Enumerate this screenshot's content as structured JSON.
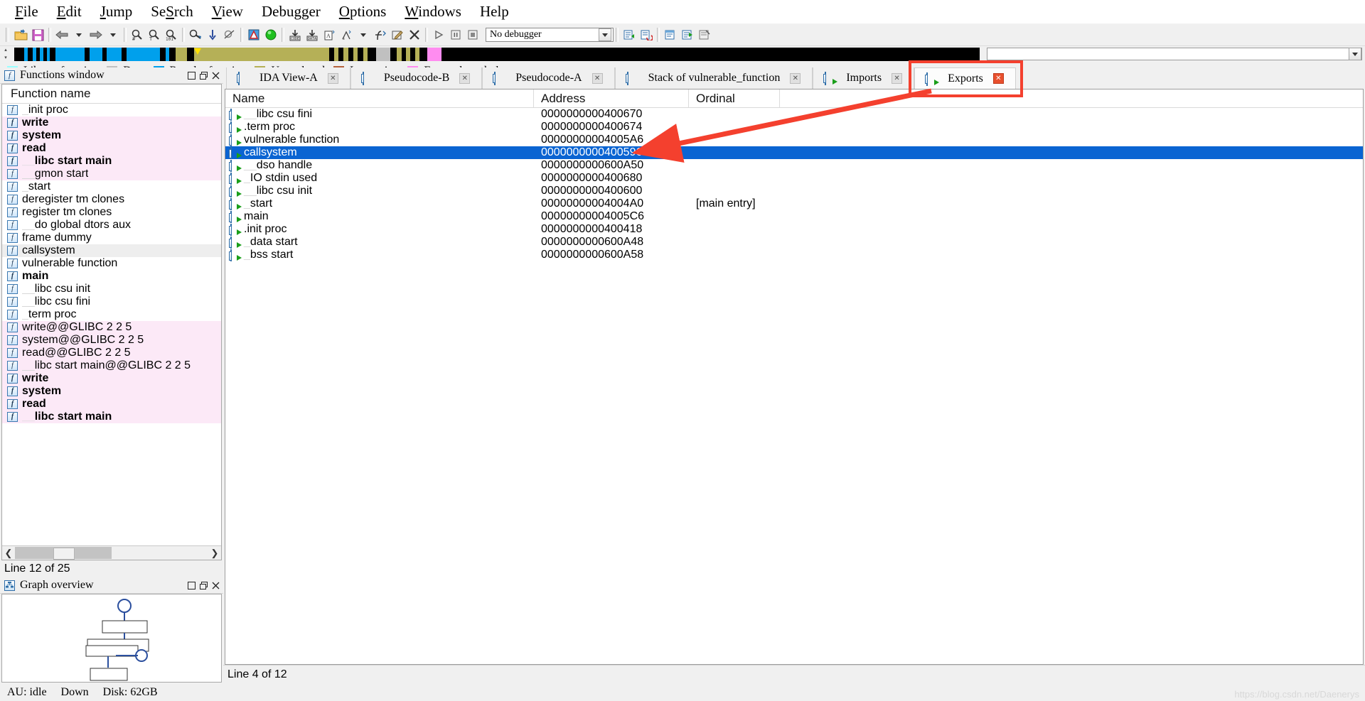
{
  "menu": {
    "items": [
      {
        "label": "File",
        "accel": "F"
      },
      {
        "label": "Edit",
        "accel": "E"
      },
      {
        "label": "Jump",
        "accel": "J"
      },
      {
        "label": "Search",
        "accel": "S"
      },
      {
        "label": "View",
        "accel": "V"
      },
      {
        "label": "Debugger",
        "accel": "g"
      },
      {
        "label": "Options",
        "accel": "O"
      },
      {
        "label": "Windows",
        "accel": "W"
      },
      {
        "label": "Help",
        "accel": "H"
      }
    ]
  },
  "toolbar": {
    "debugger_select": {
      "value": "No debugger",
      "name": "debugger-selector"
    },
    "buttons": [
      "open-file-icon",
      "save-icon",
      "nav-back-icon",
      "nav-back-dropdown-icon",
      "nav-forward-icon",
      "nav-forward-dropdown-icon",
      "search-hex-icon",
      "search-text-icon",
      "search-imm-icon",
      "jump-to-icon",
      "jump-down-icon",
      "jump-xref-icon",
      "warning-icon",
      "run-ok-icon",
      "make-code-icon",
      "make-data-icon",
      "make-ascii-icon",
      "make-struct-icon",
      "struct-dropdown-icon",
      "make-func-icon",
      "edit-func-icon",
      "undefine-icon",
      "run-icon",
      "pause-icon",
      "stop-icon",
      "analysis-refresh-icon",
      "reload-icon",
      "imports-window-icon",
      "exports-window-icon",
      "names-window-icon"
    ]
  },
  "navband": {
    "name": "navigator-band",
    "segments": [
      {
        "color": "#000000",
        "width": 0.8
      },
      {
        "color": "#00a0ec",
        "width": 0.25
      },
      {
        "color": "#000000",
        "width": 0.4
      },
      {
        "color": "#00a0ec",
        "width": 0.25
      },
      {
        "color": "#000000",
        "width": 0.3
      },
      {
        "color": "#00a0ec",
        "width": 0.25
      },
      {
        "color": "#000000",
        "width": 0.3
      },
      {
        "color": "#00a0ec",
        "width": 0.25
      },
      {
        "color": "#000000",
        "width": 0.4
      },
      {
        "color": "#00a0ec",
        "width": 2.3
      },
      {
        "color": "#000000",
        "width": 0.4
      },
      {
        "color": "#00a0ec",
        "width": 1.0
      },
      {
        "color": "#000000",
        "width": 0.3
      },
      {
        "color": "#00a0ec",
        "width": 1.2
      },
      {
        "color": "#000000",
        "width": 0.35
      },
      {
        "color": "#00a0ec",
        "width": 2.6
      },
      {
        "color": "#000000",
        "width": 0.45
      },
      {
        "color": "#00a0ec",
        "width": 0.3
      },
      {
        "color": "#000000",
        "width": 0.5
      },
      {
        "color": "#b5b057",
        "width": 0.9
      },
      {
        "color": "#000000",
        "width": 0.55
      },
      {
        "color": "#b5b057",
        "width": 10.5
      },
      {
        "color": "#000000",
        "width": 0.4
      },
      {
        "color": "#b5b057",
        "width": 0.35
      },
      {
        "color": "#000000",
        "width": 0.4
      },
      {
        "color": "#b5b057",
        "width": 0.35
      },
      {
        "color": "#000000",
        "width": 0.4
      },
      {
        "color": "#b5b057",
        "width": 0.35
      },
      {
        "color": "#000000",
        "width": 0.4
      },
      {
        "color": "#b5b057",
        "width": 0.35
      },
      {
        "color": "#000000",
        "width": 0.7
      },
      {
        "color": "#c0c0c0",
        "width": 1.1
      },
      {
        "color": "#000000",
        "width": 0.5
      },
      {
        "color": "#b5b057",
        "width": 0.35
      },
      {
        "color": "#000000",
        "width": 0.35
      },
      {
        "color": "#b5b057",
        "width": 0.35
      },
      {
        "color": "#000000",
        "width": 0.35
      },
      {
        "color": "#b5b057",
        "width": 0.35
      },
      {
        "color": "#000000",
        "width": 0.6
      },
      {
        "color": "#ff8cf0",
        "width": 1.1
      },
      {
        "color": "#000000",
        "width": 42.0
      }
    ],
    "cursor_marker_color": "#ffe000"
  },
  "legend": {
    "items": [
      {
        "label": "Library function",
        "color": "#99ffff",
        "name": "legend-library-function"
      },
      {
        "label": "Data",
        "color": "#c0c0c0",
        "name": "legend-data"
      },
      {
        "label": "Regular function",
        "color": "#00a0ec",
        "name": "legend-regular-function"
      },
      {
        "label": "Unexplored",
        "color": "#b5b057",
        "name": "legend-unexplored"
      },
      {
        "label": "Instruction",
        "color": "#b5623c",
        "name": "legend-instruction"
      },
      {
        "label": "External symbol",
        "color": "#ff8cf0",
        "name": "legend-external-symbol"
      }
    ]
  },
  "functions_panel": {
    "title": "Functions window",
    "column_header": "Function name",
    "status": "Line 12 of 25",
    "window_buttons": [
      "restore-icon",
      "maximize-icon",
      "close-icon"
    ],
    "rows": [
      {
        "name": "_init_proc",
        "display": "init proc",
        "lib": false,
        "bold": false,
        "indent": 1
      },
      {
        "name": "_write",
        "display": "write",
        "lib": true,
        "bold": true,
        "indent": 0
      },
      {
        "name": "_system",
        "display": "system",
        "lib": true,
        "bold": true,
        "indent": 0
      },
      {
        "name": "_read",
        "display": "read",
        "lib": true,
        "bold": true,
        "indent": 0
      },
      {
        "name": "___libc_start_main",
        "display": "libc start main",
        "lib": true,
        "bold": true,
        "indent": 2
      },
      {
        "name": "_gmon_start",
        "display": "gmon start",
        "lib": true,
        "bold": false,
        "indent": 2
      },
      {
        "name": "start",
        "display": "start",
        "lib": false,
        "bold": false,
        "indent": 1
      },
      {
        "name": "deregister_tm_clones",
        "display": "deregister tm clones",
        "lib": false,
        "bold": false,
        "indent": 0
      },
      {
        "name": "register_tm_clones",
        "display": "register tm clones",
        "lib": false,
        "bold": false,
        "indent": 0
      },
      {
        "name": "__do_global_dtors_aux",
        "display": "do global dtors aux",
        "lib": false,
        "bold": false,
        "indent": 2
      },
      {
        "name": "frame_dummy",
        "display": "frame dummy",
        "lib": false,
        "bold": false,
        "indent": 0
      },
      {
        "name": "callsystem",
        "display": "callsystem",
        "lib": false,
        "bold": false,
        "indent": 0,
        "selected": true
      },
      {
        "name": "vulnerable_function",
        "display": "vulnerable function",
        "lib": false,
        "bold": false,
        "indent": 0
      },
      {
        "name": "main",
        "display": "main",
        "lib": false,
        "bold": true,
        "indent": 0
      },
      {
        "name": "__libc_csu_init",
        "display": "libc csu init",
        "lib": false,
        "bold": false,
        "indent": 2
      },
      {
        "name": "__libc_csu_fini",
        "display": "libc csu fini",
        "lib": false,
        "bold": false,
        "indent": 2
      },
      {
        "name": "_term_proc",
        "display": "term proc",
        "lib": false,
        "bold": false,
        "indent": 1
      },
      {
        "name": "write@@GLIBC_2_2_5",
        "display": "write@@GLIBC 2 2 5",
        "lib": true,
        "bold": false,
        "indent": 0
      },
      {
        "name": "system@@GLIBC_2_2_5",
        "display": "system@@GLIBC 2 2 5",
        "lib": true,
        "bold": false,
        "indent": 0
      },
      {
        "name": "read@@GLIBC_2_2_5",
        "display": "read@@GLIBC 2 2 5",
        "lib": true,
        "bold": false,
        "indent": 0
      },
      {
        "name": "__libc_start_main@@GLIBC_2_2_5",
        "display": "libc start main@@GLIBC 2 2 5",
        "lib": true,
        "bold": false,
        "indent": 2
      },
      {
        "name": "write",
        "display": "write",
        "lib": true,
        "bold": true,
        "indent": 0
      },
      {
        "name": "system",
        "display": "system",
        "lib": true,
        "bold": true,
        "indent": 0
      },
      {
        "name": "read",
        "display": "read",
        "lib": true,
        "bold": true,
        "indent": 0
      },
      {
        "name": "__libc_start_main",
        "display": "libc start main",
        "lib": true,
        "bold": true,
        "indent": 2
      }
    ]
  },
  "graph_panel": {
    "title": "Graph overview",
    "window_buttons": [
      "restore-icon",
      "maximize-icon",
      "close-icon"
    ]
  },
  "tabs": [
    {
      "label": "IDA View-A",
      "icon": "document-icon",
      "closable": true,
      "active": false,
      "name": "tab-ida-view-a"
    },
    {
      "label": "Pseudocode-B",
      "icon": "document-icon",
      "closable": true,
      "active": false,
      "name": "tab-pseudocode-b"
    },
    {
      "label": "Pseudocode-A",
      "icon": "document-icon",
      "closable": true,
      "active": false,
      "name": "tab-pseudocode-a"
    },
    {
      "label": "Stack of vulnerable_function",
      "icon": "stack-icon",
      "closable": true,
      "active": false,
      "name": "tab-stack-of-vulnerable-function"
    },
    {
      "label": "Imports",
      "icon": "imports-icon",
      "closable": true,
      "active": false,
      "name": "tab-imports"
    },
    {
      "label": "Exports",
      "icon": "exports-icon",
      "closable": true,
      "active": true,
      "name": "tab-exports"
    }
  ],
  "exports_table": {
    "columns": [
      "Name",
      "Address",
      "Ordinal"
    ],
    "status": "Line 4 of 12",
    "rows": [
      {
        "name": "_libc_csu_fini",
        "display": "libc csu fini",
        "indent": 2,
        "address": "0000000000400670",
        "ordinal": ""
      },
      {
        "name": ".term_proc",
        "display": ".term proc",
        "indent": 0,
        "address": "0000000000400674",
        "ordinal": ""
      },
      {
        "name": "vulnerable_function",
        "display": "vulnerable function",
        "indent": 0,
        "address": "00000000004005A6",
        "ordinal": ""
      },
      {
        "name": "callsystem",
        "display": "callsystem",
        "indent": 0,
        "address": "0000000000400596",
        "ordinal": "",
        "selected": true
      },
      {
        "name": "__dso_handle",
        "display": "dso handle",
        "indent": 2,
        "address": "0000000000600A50",
        "ordinal": ""
      },
      {
        "name": "_IO_stdin_used",
        "display": "IO stdin used",
        "indent": 1,
        "address": "0000000000400680",
        "ordinal": ""
      },
      {
        "name": "__libc_csu_init",
        "display": "libc csu init",
        "indent": 2,
        "address": "0000000000400600",
        "ordinal": ""
      },
      {
        "name": "_start",
        "display": "start",
        "indent": 1,
        "address": "00000000004004A0",
        "ordinal": "[main entry]"
      },
      {
        "name": "main",
        "display": "main",
        "indent": 0,
        "address": "00000000004005C6",
        "ordinal": ""
      },
      {
        "name": ".init_proc",
        "display": ".init proc",
        "indent": 0,
        "address": "0000000000400418",
        "ordinal": ""
      },
      {
        "name": "_data_start",
        "display": "data start",
        "indent": 1,
        "address": "0000000000600A48",
        "ordinal": ""
      },
      {
        "name": "_bss_start",
        "display": "bss start",
        "indent": 1,
        "address": "0000000000600A58",
        "ordinal": ""
      }
    ]
  },
  "statusbar": {
    "au": "AU: idle",
    "down": "Down",
    "disk": "Disk: 62GB"
  },
  "annotations": {
    "highlight_color": "#f4402e",
    "arrow_label": "",
    "watermark": "https://blog.csdn.net/Daenerys"
  }
}
